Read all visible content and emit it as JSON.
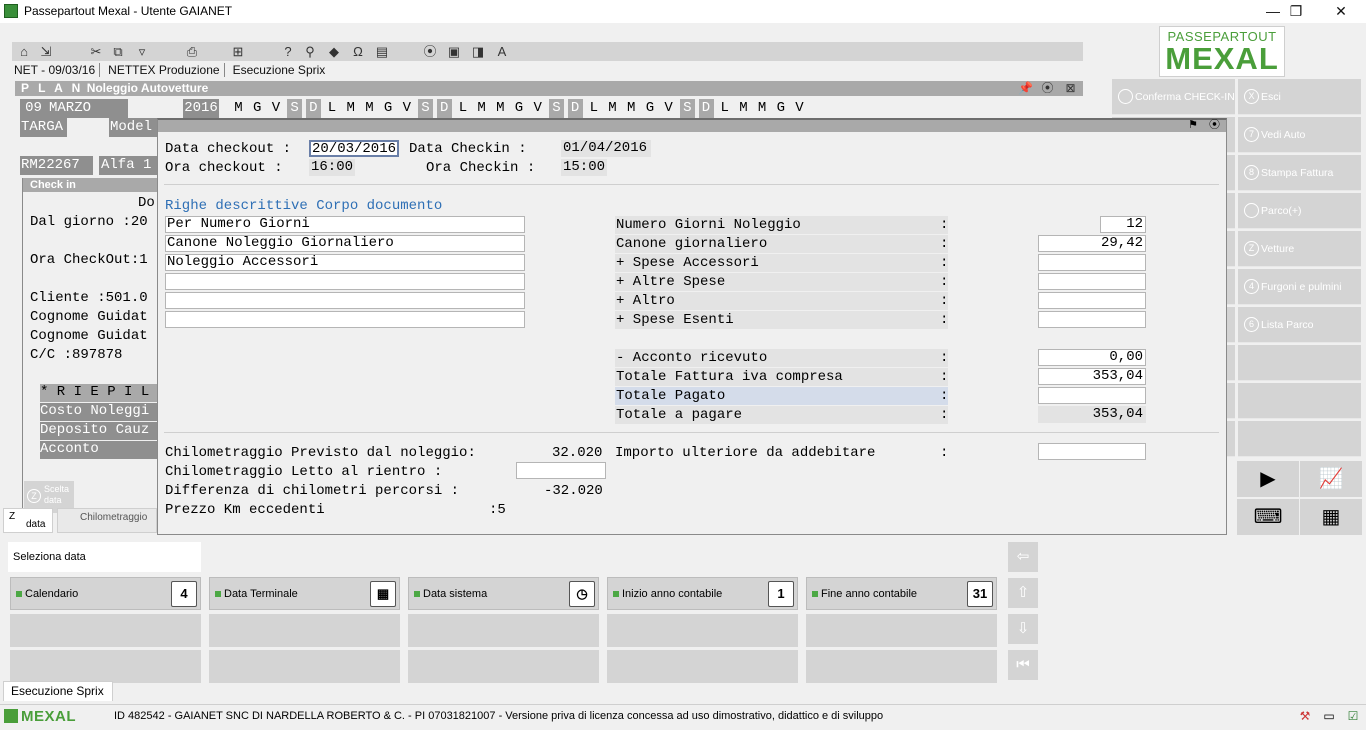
{
  "window": {
    "title": "Passepartout Mexal - Utente GAIANET",
    "minimize": "—",
    "maximize": "❐",
    "close": "✕"
  },
  "breadcrumb": [
    "NET - 09/03/16",
    "NETTEX Produzione",
    "Esecuzione Sprix"
  ],
  "logo": {
    "line1": "PASSEPARTOUT",
    "line2": "MEXAL"
  },
  "plan": {
    "header_prefix": "P L A N",
    "header_title": "Noleggio Autovetture",
    "day": "09",
    "month": "MARZO",
    "year": "2016",
    "weekdays": [
      "M",
      "G",
      "V",
      "S",
      "D",
      "L",
      "M",
      "M",
      "G",
      "V",
      "S",
      "D",
      "L",
      "M",
      "M",
      "G",
      "V",
      "S",
      "D",
      "L",
      "M",
      "M",
      "G",
      "V",
      "S",
      "D",
      "L",
      "M",
      "M",
      "G",
      "V"
    ],
    "targa_label": "TARGA",
    "modello_label": "Model",
    "targa_value": "RM22267",
    "modello_value": "Alfa 1"
  },
  "checkin_panel": {
    "title": "Check in",
    "do_label": "Do",
    "dal_giorno": "Dal giorno :20",
    "ora_checkout": "Ora CheckOut:1",
    "cliente": "Cliente :501.0",
    "cognome1": "Cognome Guidat",
    "cognome2": "Cognome Guidat",
    "cc": "C/C    :897878",
    "riepilogo": "* R I E P I L",
    "costo": "Costo Noleggi",
    "deposito": "Deposito Cauz",
    "acconto": "Acconto",
    "scelta_data_key": "Z",
    "scelta_data_label": "Scelta data",
    "tab_data_key": "Z",
    "tab_data": "data",
    "tab_chilometraggio": "Chilometraggio"
  },
  "dialog": {
    "data_checkout_label": "Data checkout :",
    "data_checkout_value": "20/03/2016",
    "data_checkin_label": "Data Checkin  :",
    "data_checkin_value": "01/04/2016",
    "ora_checkout_label": "Ora  checkout :",
    "ora_checkout_value": "16:00",
    "ora_checkin_label": "Ora  Checkin :",
    "ora_checkin_value": "15:00",
    "righe_title": "Righe descrittive Corpo documento",
    "righe": [
      "Per Numero Giorni",
      "Canone Noleggio Giornaliero",
      "Noleggio Accessori",
      "",
      "",
      ""
    ],
    "totals": [
      {
        "label": "Numero Giorni Noleggio",
        "colon": ":",
        "value": "12"
      },
      {
        "label": "Canone giornaliero",
        "colon": ":",
        "value": "29,42"
      },
      {
        "label": "+ Spese Accessori",
        "colon": ":",
        "value": ""
      },
      {
        "label": "+ Altre Spese",
        "colon": ":",
        "value": ""
      },
      {
        "label": "+ Altro",
        "colon": ":",
        "value": ""
      },
      {
        "label": "+ Spese Esenti",
        "colon": ":",
        "value": ""
      }
    ],
    "summary": [
      {
        "label": "- Acconto ricevuto",
        "colon": ":",
        "value": "0,00"
      },
      {
        "label": "Totale Fattura iva compresa",
        "colon": ":",
        "value": "353,04"
      },
      {
        "label": "Totale Pagato",
        "colon": ":",
        "value": ""
      },
      {
        "label": "Totale a pagare",
        "colon": ":",
        "value": "353,04"
      }
    ],
    "km_previsto_label": "Chilometraggio Previsto dal noleggio:",
    "km_previsto_value": "32.020",
    "km_letto_label": "Chilometraggio Letto al rientro    :",
    "km_letto_value": "",
    "km_diff_label": "Differenza di chilometri percorsi   :",
    "km_diff_value": "-32.020",
    "prezzo_km_label": "Prezzo Km eccedenti",
    "prezzo_km_value": ":5",
    "importo_label": "Importo ulteriore da addebitare",
    "importo_colon": ":",
    "importo_value": ""
  },
  "actions": [
    {
      "key": "",
      "label": "Conferma CHECK-IN"
    },
    {
      "key": "X",
      "label": "Esci"
    },
    {
      "key": "7",
      "label": "Vedi Auto"
    },
    {
      "key": "8",
      "label": "Stampa Fattura"
    },
    {
      "key": "",
      "label": "Parco(+)"
    },
    {
      "key": "Z",
      "label": "Vetture"
    },
    {
      "key": "4",
      "label": "Furgoni e pulmini"
    },
    {
      "key": "6",
      "label": "Lista Parco"
    }
  ],
  "lower": {
    "seleziona_label": "Seleziona data",
    "buttons": [
      {
        "label": "Calendario",
        "icon": "calendar-4-icon",
        "glyph": "4"
      },
      {
        "label": "Data Terminale",
        "icon": "calendar-grid-icon",
        "glyph": "▦"
      },
      {
        "label": "Data sistema",
        "icon": "calendar-clock-icon",
        "glyph": "◷"
      },
      {
        "label": "Inizio anno contabile",
        "icon": "calendar-1-icon",
        "glyph": "1"
      },
      {
        "label": "Fine anno contabile",
        "icon": "calendar-31-icon",
        "glyph": "31"
      }
    ],
    "nav": [
      "⇦",
      "⇧",
      "⇩",
      "⏮"
    ]
  },
  "tab": "Esecuzione Sprix",
  "status": {
    "brand": "MEXAL",
    "info": "ID 482542 - GAIANET SNC DI NARDELLA ROBERTO & C. - PI 07031821007 - Versione priva di licenza concessa ad uso dimostrativo, didattico e di sviluppo"
  },
  "colors": {
    "brand_green": "#4a9e3a",
    "panel_grey": "#d4d4d4",
    "link_blue": "#2e6fb5"
  }
}
